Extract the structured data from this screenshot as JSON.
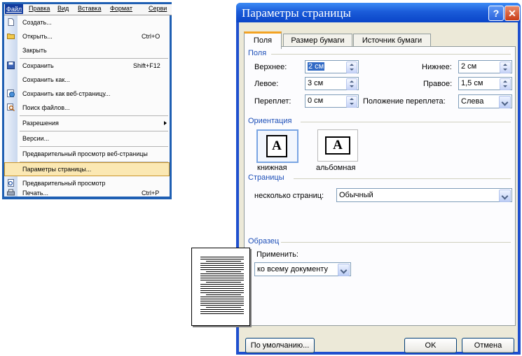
{
  "menu": {
    "bar": [
      "Файл",
      "Правка",
      "Вид",
      "Вставка",
      "Формат",
      "Серви"
    ],
    "items": [
      {
        "label": "Создать...",
        "shortcut": "",
        "icon": "new-doc-icon"
      },
      {
        "label": "Открыть...",
        "shortcut": "Ctrl+O",
        "icon": "open-folder-icon"
      },
      {
        "label": "Закрыть",
        "shortcut": "",
        "icon": ""
      },
      {
        "label": "Сохранить",
        "shortcut": "Shift+F12",
        "icon": "save-icon"
      },
      {
        "label": "Сохранить как...",
        "shortcut": "",
        "icon": ""
      },
      {
        "label": "Сохранить как веб-страницу...",
        "shortcut": "",
        "icon": "web-page-icon"
      },
      {
        "label": "Поиск файлов...",
        "shortcut": "",
        "icon": "search-files-icon"
      },
      {
        "label": "Разрешения",
        "shortcut": "",
        "icon": ""
      },
      {
        "label": "Версии...",
        "shortcut": "",
        "icon": ""
      },
      {
        "label": "Предварительный просмотр веб-страницы",
        "shortcut": "",
        "icon": ""
      },
      {
        "label": "Параметры страницы...",
        "shortcut": "",
        "icon": ""
      },
      {
        "label": "Предварительный просмотр",
        "shortcut": "",
        "icon": "print-preview-icon"
      },
      {
        "label": "Печать...",
        "shortcut": "Ctrl+P",
        "icon": "print-icon"
      }
    ]
  },
  "dialog": {
    "title": "Параметры страницы",
    "help_glyph": "?",
    "close_glyph": "✕",
    "tabs": [
      "Поля",
      "Размер бумаги",
      "Источник бумаги"
    ],
    "margins": {
      "group": "Поля",
      "top_label": "Верхнее:",
      "top_value": "2 см",
      "bottom_label": "Нижнее:",
      "bottom_value": "2 см",
      "left_label": "Левое:",
      "left_value": "3 см",
      "right_label": "Правое:",
      "right_value": "1,5 см",
      "gutter_label": "Переплет:",
      "gutter_value": "0 см",
      "gutter_pos_label": "Положение переплета:",
      "gutter_pos_value": "Слева"
    },
    "orientation": {
      "group": "Ориентация",
      "icon_letter": "A",
      "portrait": "книжная",
      "landscape": "альбомная"
    },
    "pages": {
      "group": "Страницы",
      "multiple_label": "несколько страниц:",
      "multiple_value": "Обычный"
    },
    "sample": {
      "group": "Образец",
      "apply_label": "Применить:",
      "apply_value": "ко всему документу"
    },
    "buttons": {
      "default": "По умолчанию...",
      "ok": "OK",
      "cancel": "Отмена"
    }
  },
  "colors": {
    "accent": "#1d4fb8",
    "titlebar": "#0a45c8",
    "highlight": "#fbe8b3",
    "tab_selected": "#f3a324"
  }
}
